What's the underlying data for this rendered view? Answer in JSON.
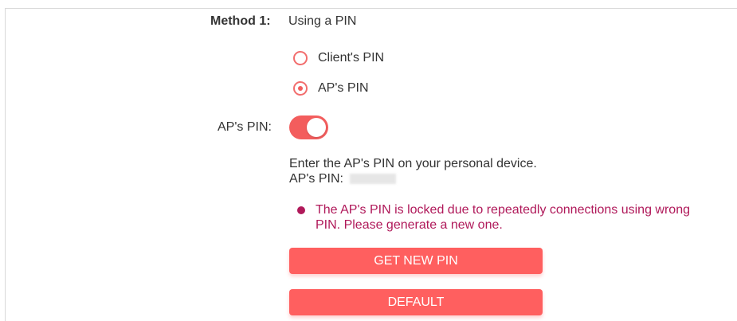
{
  "method": {
    "label": "Method 1:",
    "value": "Using a PIN"
  },
  "pin_options": [
    {
      "label": "Client's PIN",
      "selected": false
    },
    {
      "label": "AP's PIN",
      "selected": true
    }
  ],
  "ap_pin": {
    "label": "AP's PIN:",
    "toggle_enabled": true,
    "instruction": "Enter the AP's PIN on your personal device.",
    "pin_label": "AP's PIN:"
  },
  "warning": {
    "text": "The AP's PIN is locked due to repeatedly connections using wrong PIN. Please generate a new one.",
    "color": "#b0195a"
  },
  "buttons": {
    "get_new_pin": "GET NEW PIN",
    "default": "DEFAULT"
  },
  "colors": {
    "accent": "#ff5f5f",
    "toggle_on": "#f35d5d",
    "text": "#333333",
    "border": "#d8d8d8"
  },
  "icons": {
    "radio_unselected": "radio-button-icon",
    "radio_selected": "radio-button-selected-icon",
    "warning_dot": "warning-dot-icon",
    "toggle": "toggle-switch-icon"
  }
}
